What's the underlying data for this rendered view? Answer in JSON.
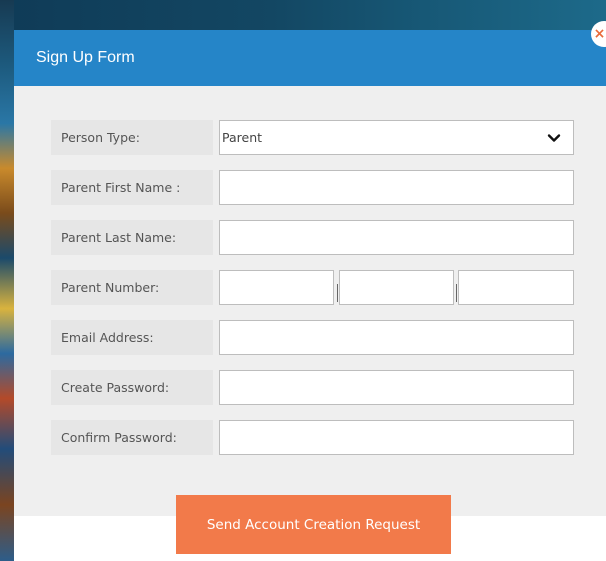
{
  "modal": {
    "title": "Sign Up Form",
    "close_label": "×"
  },
  "form": {
    "person_type": {
      "label": "Person Type:",
      "selected": "Parent"
    },
    "first_name": {
      "label": "Parent First Name :",
      "value": ""
    },
    "last_name": {
      "label": "Parent Last Name:",
      "value": ""
    },
    "number": {
      "label": "Parent Number:",
      "part1": "",
      "part2": "",
      "part3": ""
    },
    "email": {
      "label": "Email Address:",
      "value": ""
    },
    "password": {
      "label": "Create Password:",
      "value": ""
    },
    "confirm_password": {
      "label": "Confirm Password:",
      "value": ""
    }
  },
  "submit_label": "Send Account Creation Request",
  "colors": {
    "header": "#2585c8",
    "button": "#f27a4a",
    "form_bg": "#efefef"
  },
  "icons": {
    "close": "close-icon",
    "dropdown": "chevron-down-icon"
  }
}
